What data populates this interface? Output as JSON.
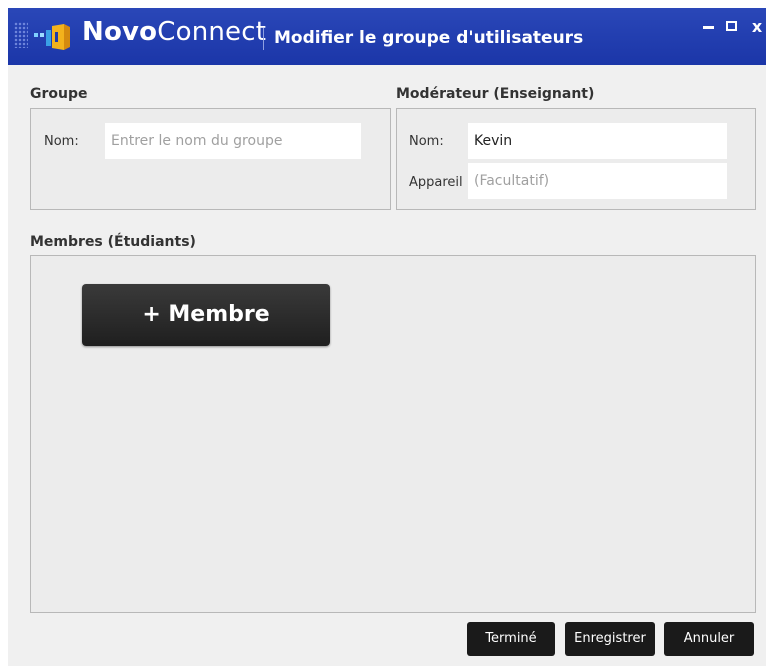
{
  "titlebar": {
    "app_name_bold": "Novo",
    "app_name_rest": "Connect",
    "title": "Modifier le groupe d'utilisateurs",
    "logo_icon": "novoconnect-logo-icon",
    "minimize_icon": "minimize-icon",
    "maximize_icon": "maximize-icon",
    "close_icon": "close-icon",
    "close_glyph": "x"
  },
  "group": {
    "label": "Groupe",
    "name_label": "Nom:",
    "name_value": "",
    "name_placeholder": "Entrer le nom du groupe"
  },
  "moderator": {
    "label": "Modérateur (Enseignant)",
    "name_label": "Nom:",
    "name_value": "Kevin",
    "device_label": "Appareil",
    "device_value": "",
    "device_placeholder": "(Facultatif)"
  },
  "members": {
    "label": "Membres (Étudiants)",
    "add_button": "+ Membre"
  },
  "footer": {
    "done": "Terminé",
    "save": "Enregistrer",
    "cancel": "Annuler"
  },
  "colors": {
    "titlebar": "#1f3bb0",
    "panel": "#ececec",
    "button": "#1a1a1a"
  }
}
